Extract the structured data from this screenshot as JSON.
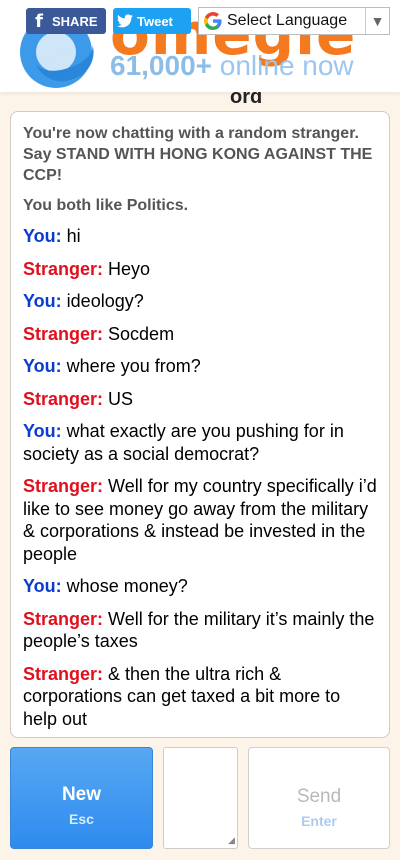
{
  "header": {
    "logo_text": "omegle",
    "online_count": "61,000+",
    "online_label": "online now",
    "share_label": "SHARE",
    "tweet_label": "Tweet",
    "language_select_value": "Select Language",
    "strip_text": "ord"
  },
  "chat": {
    "status_lines": [
      "You're now chatting with a random stranger. Say STAND WITH HONG KONG AGAINST THE CCP!",
      "You both like Politics."
    ],
    "messages": [
      {
        "speaker": "You:",
        "text": "hi"
      },
      {
        "speaker": "Stranger:",
        "text": "Heyo"
      },
      {
        "speaker": "You:",
        "text": "ideology?"
      },
      {
        "speaker": "Stranger:",
        "text": "Socdem"
      },
      {
        "speaker": "You:",
        "text": "where you from?"
      },
      {
        "speaker": "Stranger:",
        "text": "US"
      },
      {
        "speaker": "You:",
        "text": "what exactly are you pushing for in society as a social democrat?"
      },
      {
        "speaker": "Stranger:",
        "text": "Well for my country specifically i’d like to see money go away from the military & corporations & instead be invested in the people"
      },
      {
        "speaker": "You:",
        "text": "whose money?"
      },
      {
        "speaker": "Stranger:",
        "text": "Well for the military it’s mainly the people’s taxes"
      },
      {
        "speaker": "Stranger:",
        "text": "& then the ultra rich & corporations can get taxed a bit more to help out"
      }
    ]
  },
  "controls": {
    "new_label": "New",
    "new_shortcut": "Esc",
    "message_value": "",
    "send_label": "Send",
    "send_shortcut": "Enter"
  },
  "colors": {
    "you": "#0a3cd2",
    "stranger": "#e0101e",
    "new_button": "#3d96f0",
    "logo_orange": "#f4791f",
    "page_bg": "#fdf4e9"
  },
  "icons": [
    "facebook-icon",
    "twitter-bird-icon",
    "google-g-icon",
    "dropdown-arrow-icon",
    "omegle-logo-icon",
    "resize-grip-icon"
  ]
}
